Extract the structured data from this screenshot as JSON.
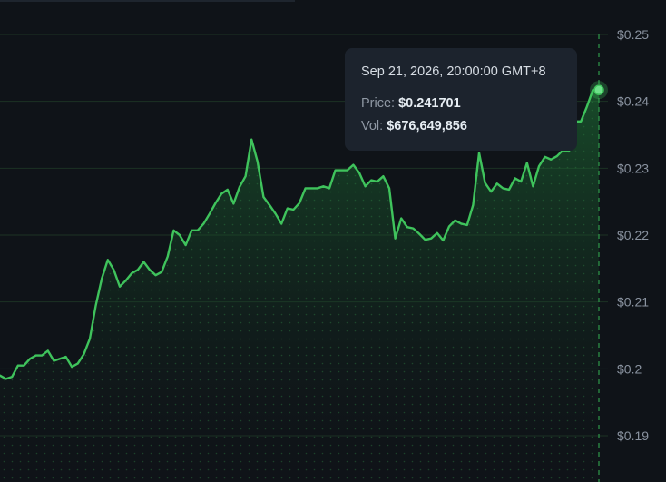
{
  "colors": {
    "background": "#0f1318",
    "line": "#3fc35c",
    "grid": "#1d3324",
    "crosshair": "#2f9a4a",
    "tooltip_bg": "#1c232d"
  },
  "tooltip": {
    "date": "Sep 21, 2026, 20:00:00 GMT+8",
    "price_label": "Price:",
    "price_value": "$0.241701",
    "vol_label": "Vol:",
    "vol_value": "$676,649,856"
  },
  "chart_data": {
    "type": "area",
    "title": "",
    "xlabel": "",
    "ylabel": "",
    "ylim": [
      0.185,
      0.2505
    ],
    "yticks": [
      0.19,
      0.2,
      0.21,
      0.22,
      0.23,
      0.24,
      0.25
    ],
    "ytick_labels": [
      "$0.19",
      "$0.2",
      "$0.21",
      "$0.22",
      "$0.23",
      "$0.24",
      "$0.25"
    ],
    "grid": true,
    "y_axis_position": "right",
    "x": [
      0,
      1,
      2,
      3,
      4,
      5,
      6,
      7,
      8,
      9,
      10,
      11,
      12,
      13,
      14,
      15,
      16,
      17,
      18,
      19,
      20,
      21,
      22,
      23,
      24,
      25,
      26,
      27,
      28,
      29,
      30,
      31,
      32,
      33,
      34,
      35,
      36,
      37,
      38,
      39,
      40,
      41,
      42,
      43,
      44,
      45,
      46,
      47,
      48,
      49,
      50,
      51,
      52,
      53,
      54,
      55,
      56,
      57,
      58,
      59,
      60,
      61,
      62,
      63,
      64,
      65,
      66,
      67,
      68,
      69,
      70,
      71,
      72,
      73,
      74,
      75,
      76,
      77,
      78,
      79,
      80,
      81,
      82,
      83,
      84,
      85,
      86,
      87,
      88,
      89,
      90,
      91,
      92,
      93,
      94,
      95,
      96,
      97,
      98,
      99,
      100,
      101,
      102,
      103,
      104,
      105,
      106,
      107,
      108,
      109,
      110
    ],
    "values": [
      0.199,
      0.1985,
      0.1988,
      0.2005,
      0.2005,
      0.2015,
      0.202,
      0.202,
      0.2027,
      0.2012,
      0.2015,
      0.2018,
      0.2003,
      0.2008,
      0.2022,
      0.2045,
      0.2095,
      0.2135,
      0.2163,
      0.2148,
      0.2123,
      0.2132,
      0.2143,
      0.2148,
      0.216,
      0.2148,
      0.214,
      0.2145,
      0.2168,
      0.2207,
      0.22,
      0.2185,
      0.2207,
      0.2207,
      0.2217,
      0.2232,
      0.2248,
      0.2262,
      0.2268,
      0.2247,
      0.2272,
      0.2288,
      0.2343,
      0.231,
      0.2257,
      0.2245,
      0.2232,
      0.2217,
      0.224,
      0.2238,
      0.2248,
      0.227,
      0.227,
      0.227,
      0.2273,
      0.227,
      0.2297,
      0.2297,
      0.2297,
      0.2305,
      0.2293,
      0.2273,
      0.2282,
      0.228,
      0.2288,
      0.227,
      0.2195,
      0.2225,
      0.2212,
      0.221,
      0.2202,
      0.2193,
      0.2195,
      0.2203,
      0.2192,
      0.2213,
      0.2222,
      0.2217,
      0.2215,
      0.2245,
      0.2323,
      0.2278,
      0.2265,
      0.2277,
      0.227,
      0.2268,
      0.2285,
      0.228,
      0.2308,
      0.2273,
      0.2303,
      0.2317,
      0.2313,
      0.2318,
      0.2327,
      0.2325,
      0.237,
      0.237,
      0.2392,
      0.2417,
      0.2417
    ]
  }
}
